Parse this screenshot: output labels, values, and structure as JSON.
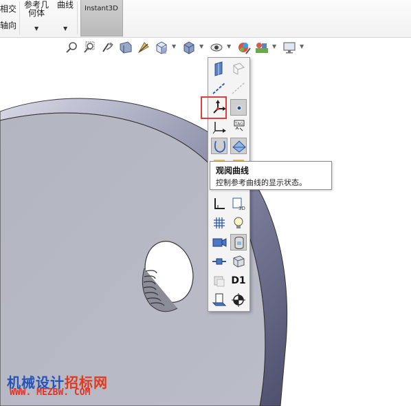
{
  "ribbon": {
    "partial_left_top": "相交",
    "partial_left_bottom": "轴向",
    "ref_geometry_line1": "参考几",
    "ref_geometry_line2": "何体",
    "curves_label": "曲线",
    "instant3d_label": "Instant3D"
  },
  "view_toolbar": {
    "icons": [
      "zoom-to-fit-icon",
      "zoom-to-area-icon",
      "previous-view-icon",
      "section-view-icon",
      "dynamic-annotation-icon",
      "view-orientation-icon",
      "display-style-icon",
      "hide-show-items-icon",
      "edit-appearance-icon",
      "apply-scene-icon",
      "view-settings-icon"
    ]
  },
  "flyout": {
    "items": [
      "view-planes-icon",
      "view-all-planes-icon",
      "view-axes-icon",
      "view-temporary-axes-icon",
      "view-origins-icon",
      "view-points-icon",
      "view-coordinate-systems-icon",
      "view-sketch-relations-icon",
      "view-curves-icon",
      "view-parting-lines-icon",
      "view-sketches-icon",
      "view-3d-sketches-icon",
      "view-dimension-names-icon",
      "view-lights-icon",
      "view-grid-icon",
      "view-cameras-icon",
      "view-decals-icon",
      "view-routing-points-icon",
      "view-weld-beads-icon",
      "view-annotations-icon",
      "view-primary-dims-icon",
      "view-sketch-planes-icon",
      "view-center-of-mass-icon"
    ],
    "d1_label": "D1"
  },
  "tooltip": {
    "title": "观阅曲线",
    "description": "控制参考曲线的显示状态。"
  },
  "watermark": {
    "line1_a": "机械设计",
    "line1_b": "招标网",
    "line2": "WWW. MEZBW. COM"
  },
  "colors": {
    "face": "#b4b6c2",
    "rim": "#6b6d8c",
    "highlight_box": "#e23b3b",
    "watermark_blue": "#2553b8",
    "watermark_red": "#e03a1e"
  }
}
